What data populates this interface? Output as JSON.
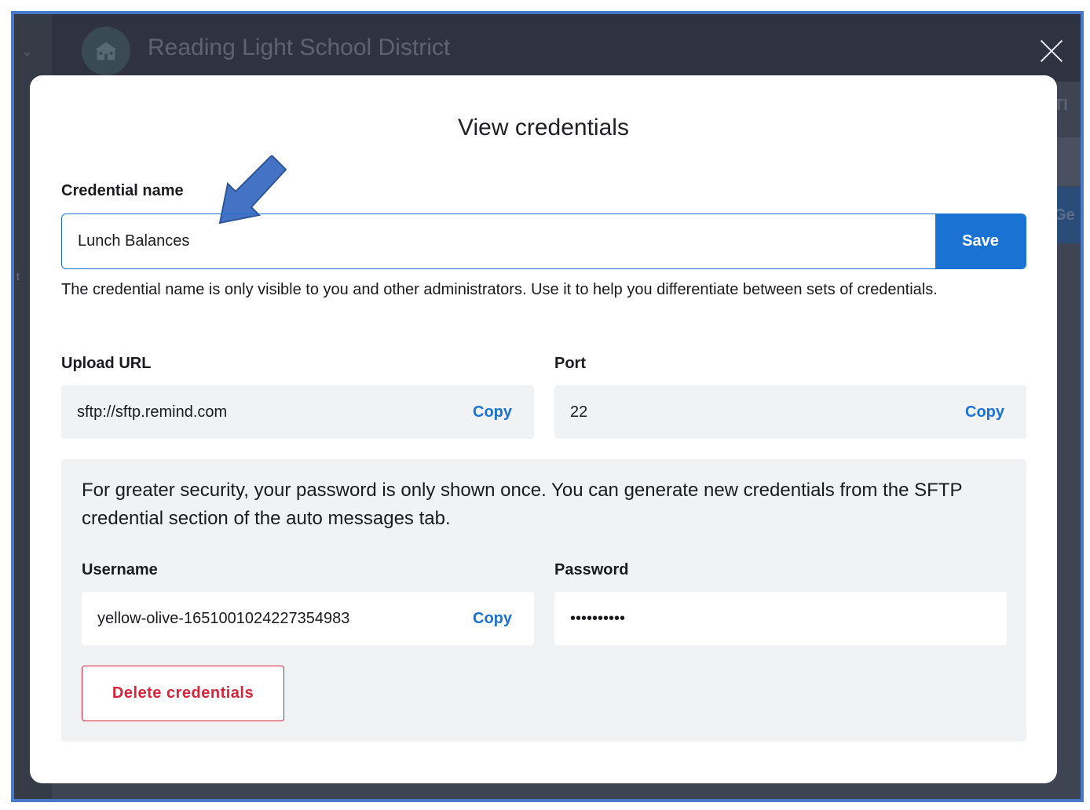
{
  "background": {
    "district_name": "Reading Light School District",
    "tab_peek": "TI",
    "button_peek": "Ge"
  },
  "modal": {
    "title": "View credentials",
    "credential_name": {
      "label": "Credential name",
      "value": "Lunch Balances",
      "save_label": "Save",
      "help": "The credential name is only visible to you and other administrators. Use it to help you differentiate between sets of credentials."
    },
    "upload_url": {
      "label": "Upload URL",
      "value": "sftp://sftp.remind.com",
      "copy_label": "Copy"
    },
    "port": {
      "label": "Port",
      "value": "22",
      "copy_label": "Copy"
    },
    "security": {
      "note": "For greater security, your password is only shown once. You can generate new credentials from the SFTP credential section of the auto messages tab.",
      "username": {
        "label": "Username",
        "value": "yellow-olive-1651001024227354983",
        "copy_label": "Copy"
      },
      "password": {
        "label": "Password",
        "value": "••••••••••"
      },
      "delete_label": "Delete credentials"
    }
  },
  "colors": {
    "accent": "#1a73d2",
    "danger": "#d8233a",
    "frame_border": "#4a79c9",
    "annotation_arrow": "#4472c4"
  }
}
